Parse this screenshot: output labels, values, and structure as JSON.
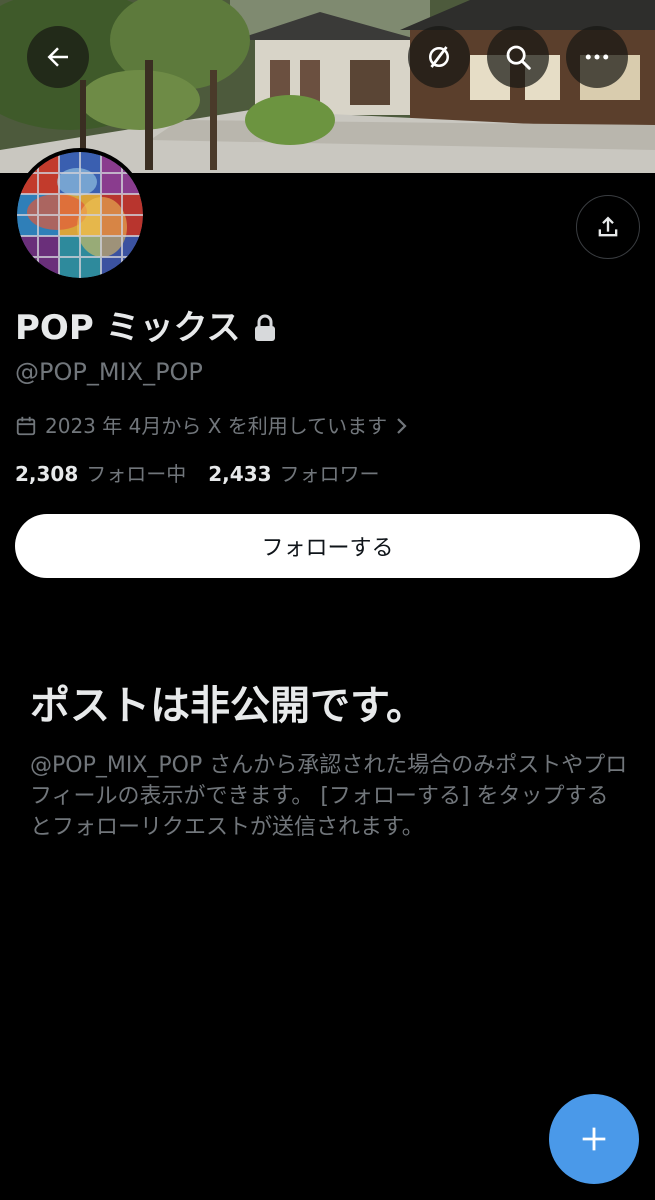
{
  "profile": {
    "display_name": "POP ミックス",
    "handle": "@POP_MIX_POP",
    "joined": "2023 年 4月から X を利用しています",
    "following_count": "2,308",
    "following_label": "フォロー中",
    "followers_count": "2,433",
    "followers_label": "フォロワー",
    "follow_button": "フォローする"
  },
  "private_notice": {
    "title": "ポストは非公開です。",
    "description": "@POP_MIX_POP さんから承認された場合のみポストやプロフィールの表示ができます。 [フォローする] をタップするとフォローリクエストが送信されます。"
  },
  "icons": {
    "back": "back-arrow-icon",
    "grok": "grok-icon",
    "search": "search-icon",
    "more": "more-icon",
    "share": "share-icon",
    "lock": "lock-icon",
    "calendar": "calendar-icon",
    "chevron": "chevron-right-icon",
    "compose": "plus-icon"
  },
  "colors": {
    "background": "#000000",
    "text_primary": "#e7e9ea",
    "text_secondary": "#71767b",
    "follow_button_bg": "#ffffff",
    "fab": "#4a99e9"
  }
}
